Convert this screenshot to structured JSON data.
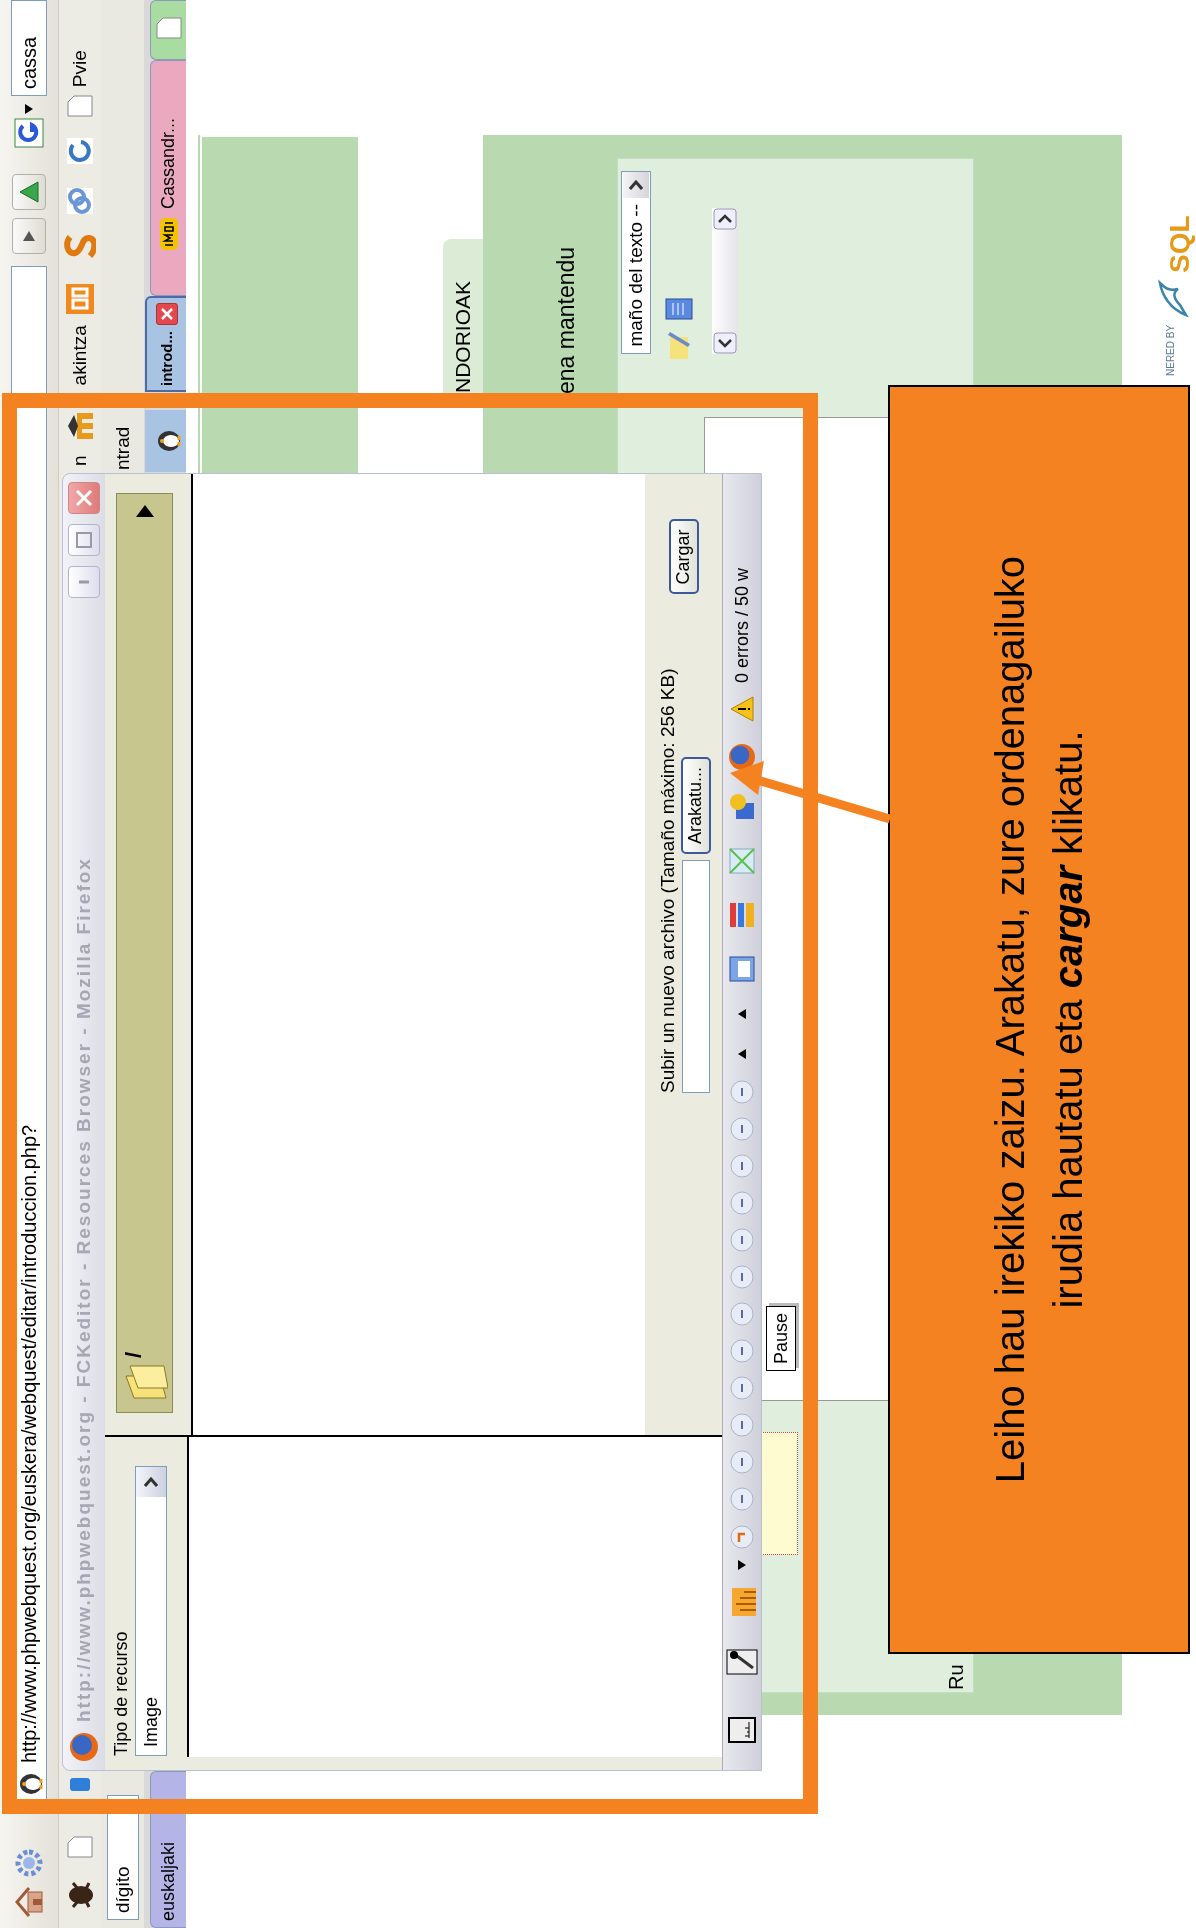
{
  "address_bar": {
    "url": "http://www.phpwebquest.org/euskera/webquest/editar/introduccion.php?",
    "search": "cassa"
  },
  "bookmarks": [
    {
      "label": "n"
    },
    {
      "label": "akintza"
    },
    {
      "label": "Pvie"
    }
  ],
  "search_row": {
    "field": "dígito",
    "label": "ntrad"
  },
  "tabs": [
    {
      "label": "euskaljaki",
      "selected": false,
      "color": "#b4b4e6"
    },
    {
      "label": "introd...",
      "selected": true,
      "color": "#a9c3e3"
    },
    {
      "label": "Cassandr...",
      "selected": false,
      "color": "#eaa9bf"
    },
    {
      "selected": false,
      "color": "#a8dca0"
    }
  ],
  "page": {
    "tab_label": "NDORIOAK",
    "heading": "ena mantendu",
    "font_size_select": "maño del texto --",
    "footer_label": "Ru",
    "logo_caption": "NERED BY",
    "logo_text": "SQL"
  },
  "popup": {
    "title": "http://www.phpwebquest.org - FCKeditor - Resources Browser - Mozilla Firefox",
    "active": false,
    "resource_type_label": "Tipo de recurso",
    "resource_type": "Image",
    "folder": "/",
    "upload_label": "Subir un nuevo archivo (Tamaño máximo: 256 KB)",
    "browse_button": "Arakatu...",
    "upload_button": "Cargar",
    "status": "0 errors / 50 w"
  },
  "tooltip": "Pause",
  "callout": {
    "lines": [
      "Leiho hau irekiko zaizu. Arakatu, zure ordenagailuko",
      "irudia hautatu eta **cargar** klikatu."
    ]
  }
}
